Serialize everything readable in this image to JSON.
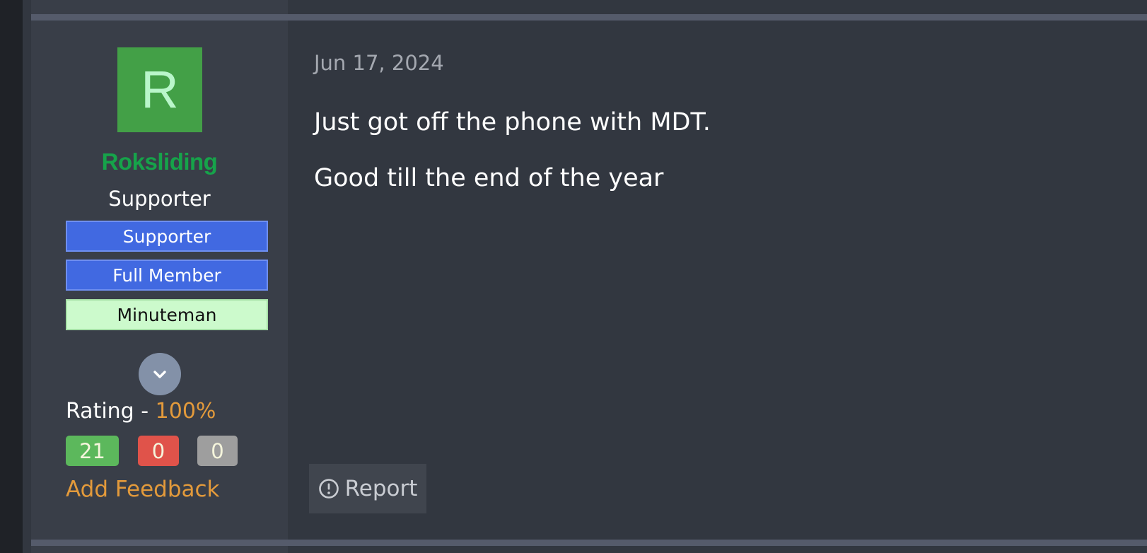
{
  "user": {
    "avatar_letter": "R",
    "avatar_bg": "#43a047",
    "avatar_fg": "#b9f6ca",
    "name": "Roksliding",
    "name_color": "#16a34a",
    "title": "Supporter"
  },
  "banners": [
    {
      "label": "Supporter",
      "bg": "#4169e1",
      "border": "#6f8ff0",
      "color": "#ffffff"
    },
    {
      "label": "Full Member",
      "bg": "#4169e1",
      "border": "#6f8ff0",
      "color": "#ffffff"
    },
    {
      "label": "Minuteman",
      "bg": "#ccfacc",
      "border": "#a6e0a6",
      "color": "#111111"
    }
  ],
  "expand_icon": "chevron-down-icon",
  "rating": {
    "label": "Rating",
    "separator": " - ",
    "value": "100%"
  },
  "feedback_counts": {
    "positive": {
      "value": "21",
      "bg": "#5cb85c"
    },
    "negative": {
      "value": "0",
      "bg": "#e0534a"
    },
    "neutral": {
      "value": "0",
      "bg": "#9e9e9e"
    }
  },
  "add_feedback_label": "Add Feedback",
  "post": {
    "date": "Jun 17, 2024",
    "paragraphs": [
      "Just got off the phone with MDT.",
      "Good till the end of the year"
    ]
  },
  "actions": {
    "report_icon": "exclamation-circle-icon",
    "report_label": "Report"
  },
  "colors": {
    "accent": "#16a34a",
    "link": "#e39a3b",
    "background": "#323740",
    "sidebar": "#393e48"
  }
}
